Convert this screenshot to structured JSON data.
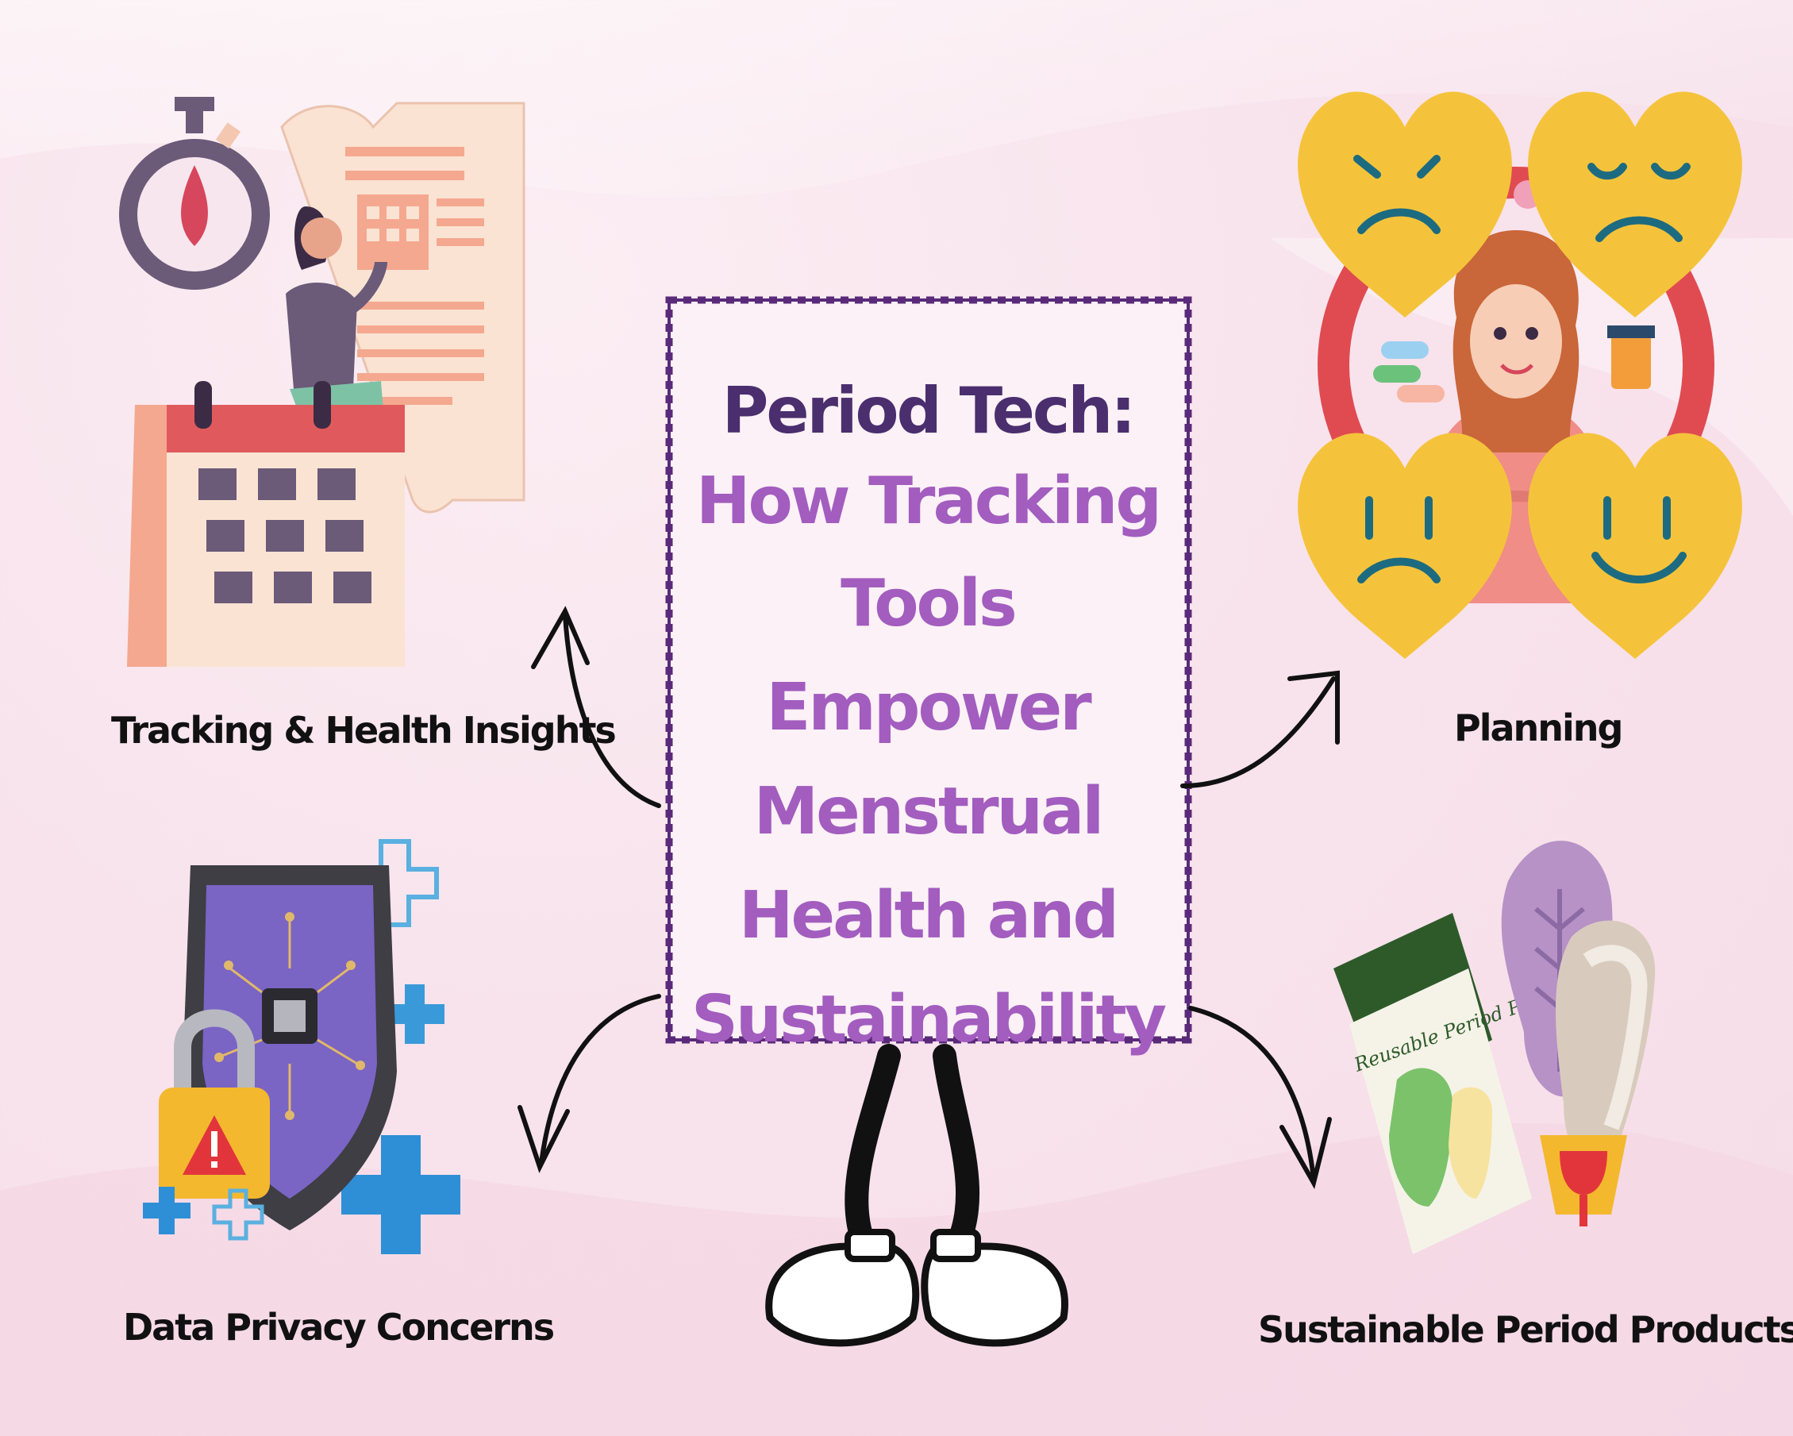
{
  "title": {
    "line1": "Period Tech:",
    "line2": "How Tracking",
    "line3": "Tools Empower",
    "line4": "Menstrual",
    "line5": "Health and",
    "line6": "Sustainability"
  },
  "nodes": [
    {
      "label": "Tracking & Health Insights",
      "icon": "calendar-stopwatch-woman-icon"
    },
    {
      "label": "Planning",
      "icon": "moods-hearts-woman-icon"
    },
    {
      "label": "Data Privacy Concerns",
      "icon": "shield-padlock-warning-icon"
    },
    {
      "label": "Sustainable Period Products",
      "icon": "reusable-pads-cup-icon"
    }
  ],
  "packaging_text": "Reusable Period Pad",
  "colors": {
    "title_dark": "#4a2e6e",
    "title_accent": "#a25dbf",
    "border": "#5a2a7a",
    "heart_yellow": "#f5c33b",
    "ring_red": "#e04b52"
  }
}
